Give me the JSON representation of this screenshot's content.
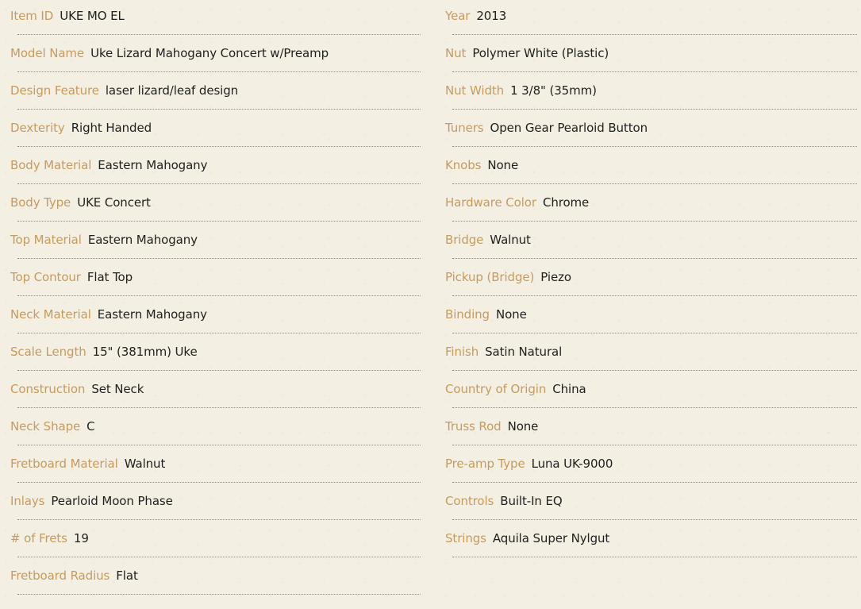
{
  "specs_left": [
    {
      "label": "Item ID",
      "value": "UKE MO EL"
    },
    {
      "label": "Model Name",
      "value": "Uke Lizard Mahogany Concert w/Preamp"
    },
    {
      "label": "Design Feature",
      "value": "laser lizard/leaf design"
    },
    {
      "label": "Dexterity",
      "value": "Right Handed"
    },
    {
      "label": "Body Material",
      "value": "Eastern Mahogany"
    },
    {
      "label": "Body Type",
      "value": "UKE Concert"
    },
    {
      "label": "Top Material",
      "value": "Eastern Mahogany"
    },
    {
      "label": "Top Contour",
      "value": "Flat Top"
    },
    {
      "label": "Neck Material",
      "value": "Eastern Mahogany"
    },
    {
      "label": "Scale Length",
      "value": "15\" (381mm) Uke"
    },
    {
      "label": "Construction",
      "value": "Set Neck"
    },
    {
      "label": "Neck Shape",
      "value": "C"
    },
    {
      "label": "Fretboard Material",
      "value": "Walnut"
    },
    {
      "label": "Inlays",
      "value": "Pearloid Moon Phase"
    },
    {
      "label": "# of Frets",
      "value": "19"
    },
    {
      "label": "Fretboard Radius",
      "value": "Flat"
    }
  ],
  "specs_right": [
    {
      "label": "Year",
      "value": "2013"
    },
    {
      "label": "Nut",
      "value": "Polymer White (Plastic)"
    },
    {
      "label": "Nut Width",
      "value": "1 3/8\" (35mm)"
    },
    {
      "label": "Tuners",
      "value": "Open Gear Pearloid Button"
    },
    {
      "label": "Knobs",
      "value": "None"
    },
    {
      "label": "Hardware Color",
      "value": "Chrome"
    },
    {
      "label": "Bridge",
      "value": "Walnut"
    },
    {
      "label": "Pickup (Bridge)",
      "value": "Piezo"
    },
    {
      "label": "Binding",
      "value": "None"
    },
    {
      "label": "Finish",
      "value": "Satin Natural"
    },
    {
      "label": "Country of Origin",
      "value": "China"
    },
    {
      "label": "Truss Rod",
      "value": "None"
    },
    {
      "label": "Pre-amp Type",
      "value": "Luna UK-9000"
    },
    {
      "label": "Controls",
      "value": "Built-In EQ"
    },
    {
      "label": "Strings",
      "value": "Aquila Super Nylgut"
    }
  ],
  "colors": {
    "label": "#c79a5e",
    "value": "#1f1f1f",
    "background": "#f4efe3"
  }
}
